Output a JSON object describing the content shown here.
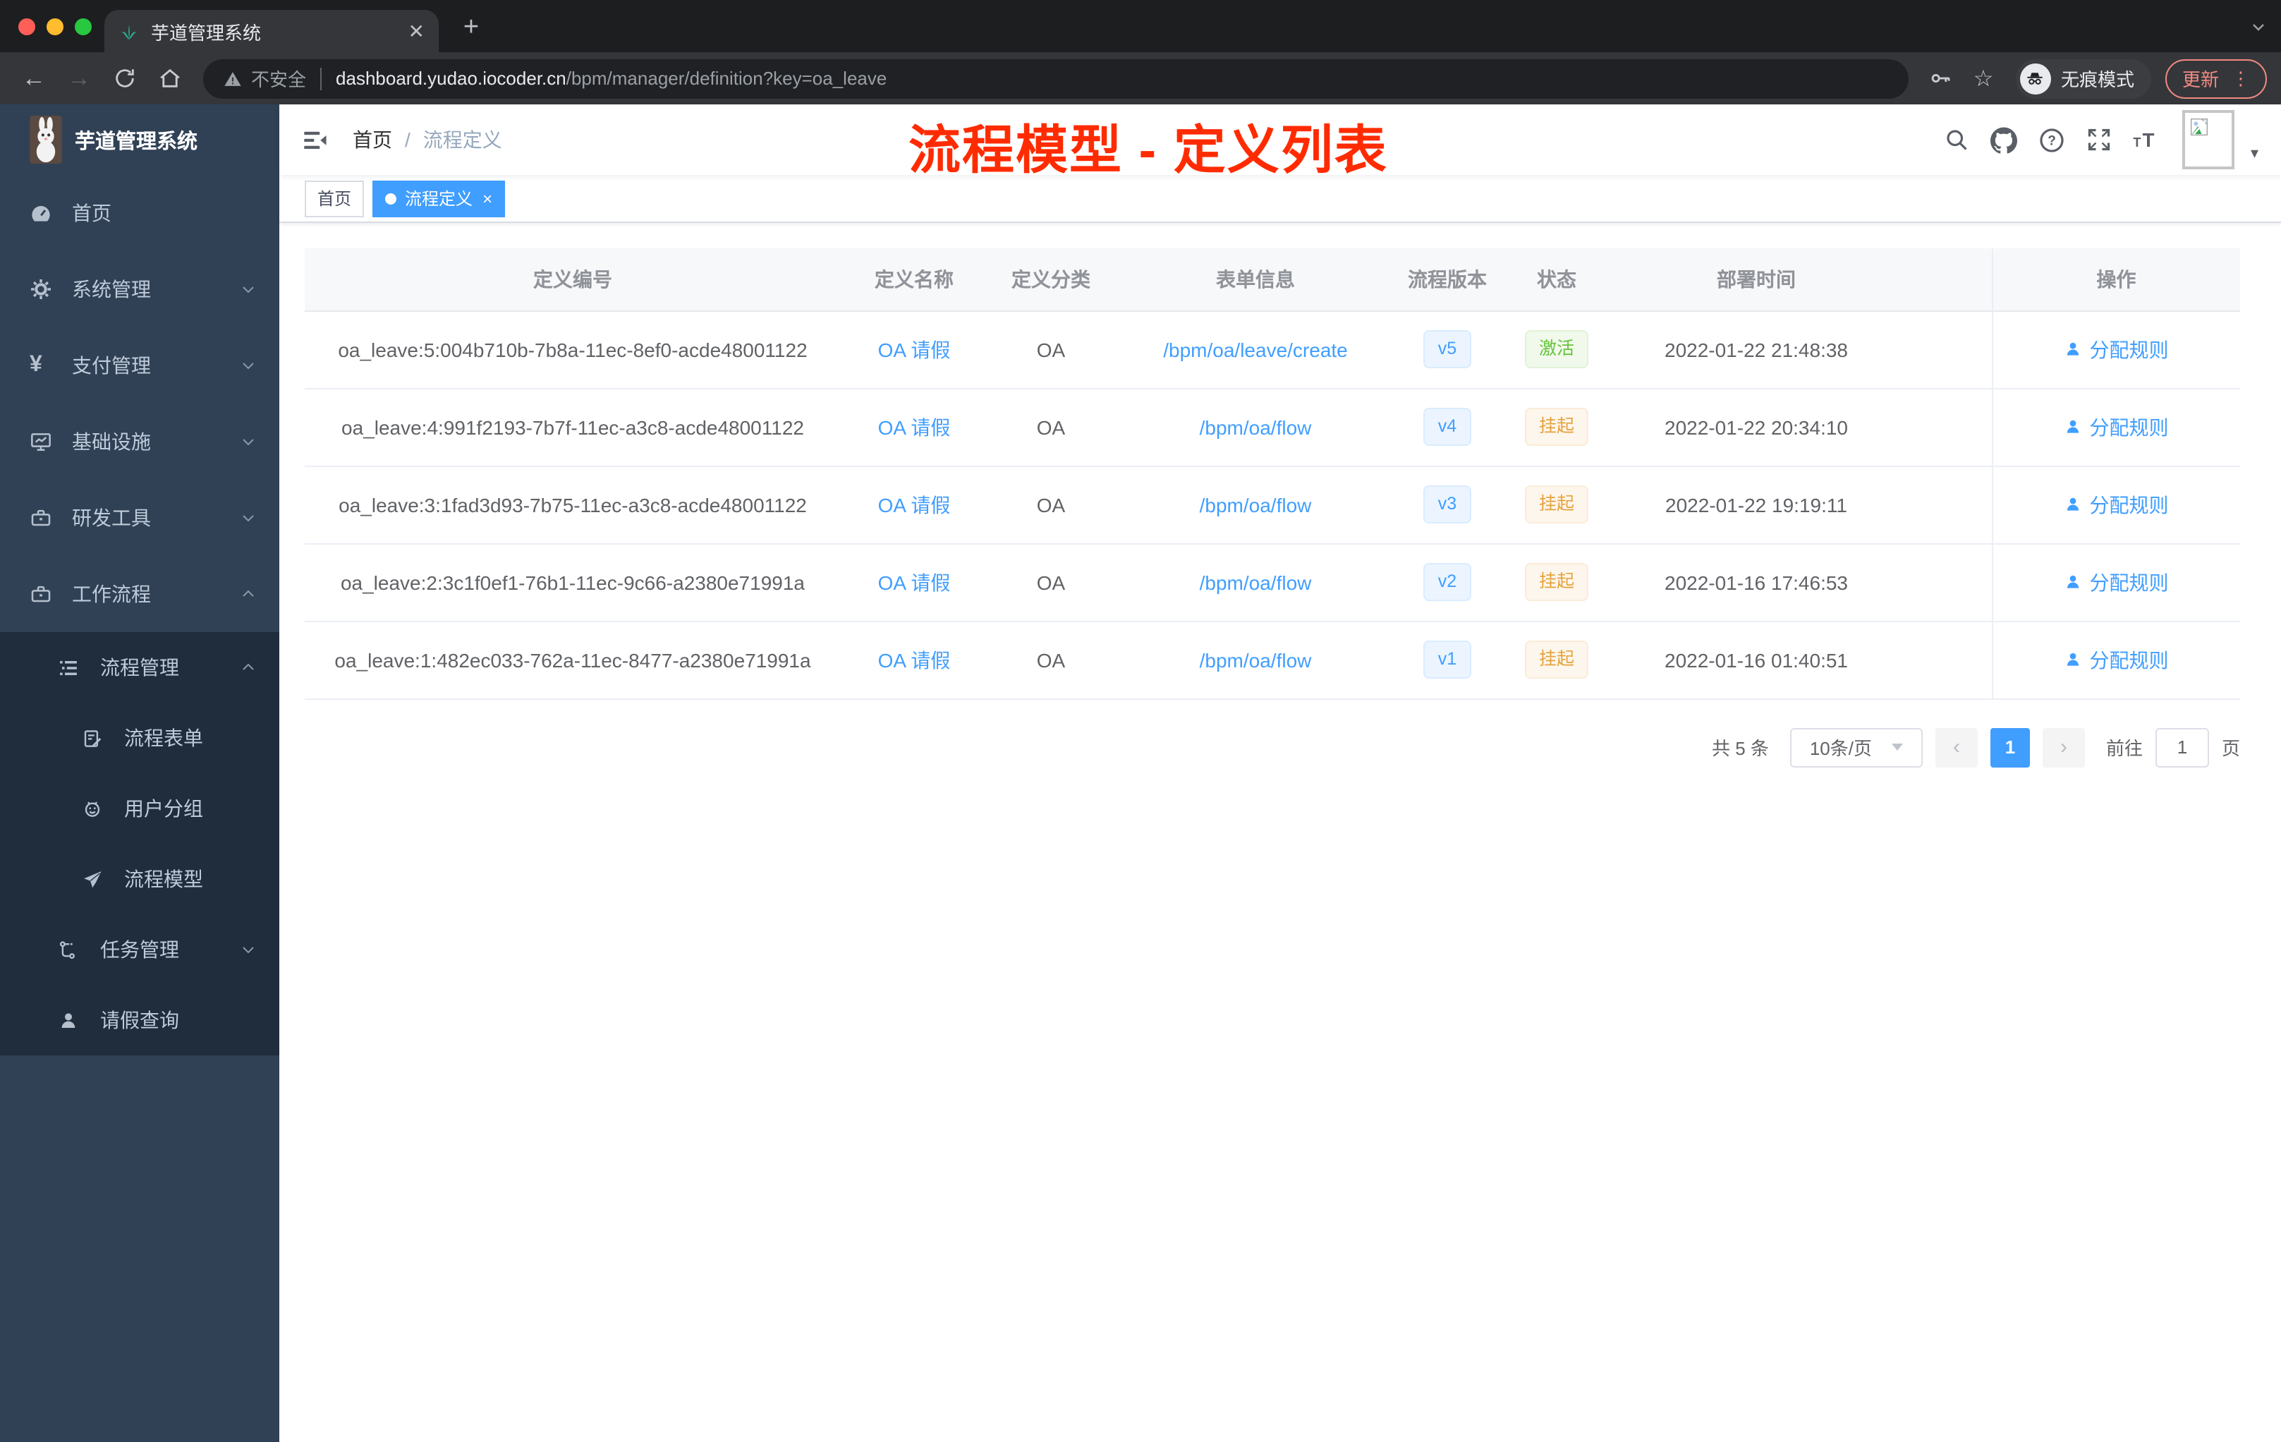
{
  "chrome": {
    "tab_title": "芋道管理系统",
    "new_tab_label": "+",
    "security_label": "不安全",
    "url_host": "dashboard.yudao.iocoder.cn",
    "url_path": "/bpm/manager/definition?key=oa_leave",
    "incognito_label": "无痕模式",
    "update_label": "更新",
    "update_dots": "⋮",
    "back": "←",
    "forward": "→"
  },
  "sidebar": {
    "logo_title": "芋道管理系统",
    "items": [
      {
        "label": "首页",
        "icon": "dashboard-icon"
      },
      {
        "label": "系统管理",
        "icon": "gear-icon",
        "chevron": "down"
      },
      {
        "label": "支付管理",
        "icon": "yen-icon",
        "chevron": "down"
      },
      {
        "label": "基础设施",
        "icon": "monitor-icon",
        "chevron": "down"
      },
      {
        "label": "研发工具",
        "icon": "toolbox-icon",
        "chevron": "down"
      },
      {
        "label": "工作流程",
        "icon": "toolbox-icon",
        "chevron": "up"
      }
    ],
    "submenu": [
      {
        "label": "流程管理",
        "icon": "list-icon",
        "chevron": "up"
      },
      {
        "label": "流程表单",
        "icon": "form-icon"
      },
      {
        "label": "用户分组",
        "icon": "face-icon"
      },
      {
        "label": "流程模型",
        "icon": "paper-plane-icon"
      },
      {
        "label": "任务管理",
        "icon": "tree-icon",
        "chevron": "down"
      },
      {
        "label": "请假查询",
        "icon": "person-icon"
      }
    ],
    "yen_glyph": "¥"
  },
  "navbar": {
    "breadcrumb_home": "首页",
    "breadcrumb_sep": "/",
    "breadcrumb_current": "流程定义",
    "annotation": "流程模型 - 定义列表",
    "avatar_caret": "▾"
  },
  "tags": [
    {
      "label": "首页",
      "active": false
    },
    {
      "label": "流程定义",
      "active": true,
      "close": "×"
    }
  ],
  "table": {
    "columns": [
      "定义编号",
      "定义名称",
      "定义分类",
      "表单信息",
      "流程版本",
      "状态",
      "部署时间",
      "",
      "操作"
    ],
    "rows": [
      {
        "id": "oa_leave:5:004b710b-7b8a-11ec-8ef0-acde48001122",
        "name": "OA 请假",
        "category": "OA",
        "form": "/bpm/oa/leave/create",
        "version": "v5",
        "status": "激活",
        "status_type": "success",
        "deploy_time": "2022-01-22 21:48:38",
        "action": "分配规则"
      },
      {
        "id": "oa_leave:4:991f2193-7b7f-11ec-a3c8-acde48001122",
        "name": "OA 请假",
        "category": "OA",
        "form": "/bpm/oa/flow",
        "version": "v4",
        "status": "挂起",
        "status_type": "warning",
        "deploy_time": "2022-01-22 20:34:10",
        "action": "分配规则"
      },
      {
        "id": "oa_leave:3:1fad3d93-7b75-11ec-a3c8-acde48001122",
        "name": "OA 请假",
        "category": "OA",
        "form": "/bpm/oa/flow",
        "version": "v3",
        "status": "挂起",
        "status_type": "warning",
        "deploy_time": "2022-01-22 19:19:11",
        "action": "分配规则"
      },
      {
        "id": "oa_leave:2:3c1f0ef1-76b1-11ec-9c66-a2380e71991a",
        "name": "OA 请假",
        "category": "OA",
        "form": "/bpm/oa/flow",
        "version": "v2",
        "status": "挂起",
        "status_type": "warning",
        "deploy_time": "2022-01-16 17:46:53",
        "action": "分配规则"
      },
      {
        "id": "oa_leave:1:482ec033-762a-11ec-8477-a2380e71991a",
        "name": "OA 请假",
        "category": "OA",
        "form": "/bpm/oa/flow",
        "version": "v1",
        "status": "挂起",
        "status_type": "warning",
        "deploy_time": "2022-01-16 01:40:51",
        "action": "分配规则"
      }
    ]
  },
  "pagination": {
    "total": "共 5 条",
    "page_size": "10条/页",
    "prev": "‹",
    "page": "1",
    "next": "›",
    "goto_label": "前往",
    "goto_value": "1",
    "unit_label": "页"
  },
  "colors": {
    "accent": "#409eff",
    "annotation_red": "#ff2b00",
    "success": "#67c23a",
    "warning": "#e6a23c",
    "sidebar_bg": "#304156",
    "submenu_bg": "#1f2d3d",
    "chrome_update": "#f28b82"
  }
}
